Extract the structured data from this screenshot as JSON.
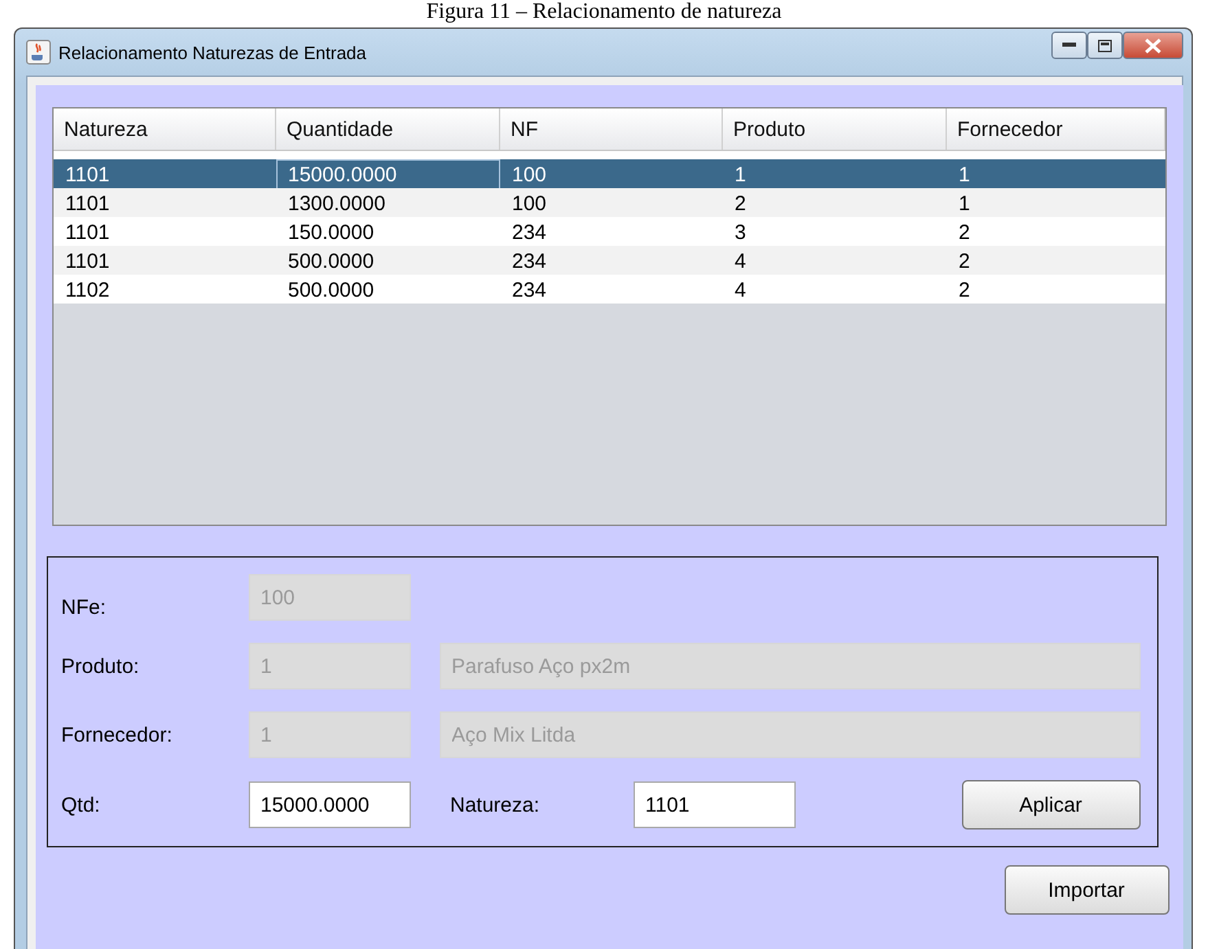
{
  "caption": "Figura 11 – Relacionamento de natureza",
  "window": {
    "title": "Relacionamento Naturezas de Entrada"
  },
  "table": {
    "columns": [
      "Natureza",
      "Quantidade",
      "NF",
      "Produto",
      "Fornecedor"
    ],
    "rows": [
      {
        "cells": [
          "1101",
          "15000.0000",
          "100",
          "1",
          "1"
        ],
        "selected": true
      },
      {
        "cells": [
          "1101",
          "1300.0000",
          "100",
          "2",
          "1"
        ],
        "selected": false
      },
      {
        "cells": [
          "1101",
          "150.0000",
          "234",
          "3",
          "2"
        ],
        "selected": false
      },
      {
        "cells": [
          "1101",
          "500.0000",
          "234",
          "4",
          "2"
        ],
        "selected": false
      },
      {
        "cells": [
          "1102",
          "500.0000",
          "234",
          "4",
          "2"
        ],
        "selected": false
      }
    ]
  },
  "form": {
    "nfe": {
      "label": "NFe:",
      "value": "100",
      "disabled": true
    },
    "produto": {
      "label": "Produto:",
      "value": "1",
      "description": "Parafuso Aço px2m",
      "disabled": true
    },
    "fornecedor": {
      "label": "Fornecedor:",
      "value": "1",
      "description": "Aço Mix Litda",
      "disabled": true
    },
    "qtd": {
      "label": "Qtd:",
      "value": "15000.0000",
      "disabled": false
    },
    "natureza": {
      "label": "Natureza:",
      "value": "1101",
      "disabled": false
    },
    "apply_button": "Aplicar"
  },
  "import_button": "Importar"
}
